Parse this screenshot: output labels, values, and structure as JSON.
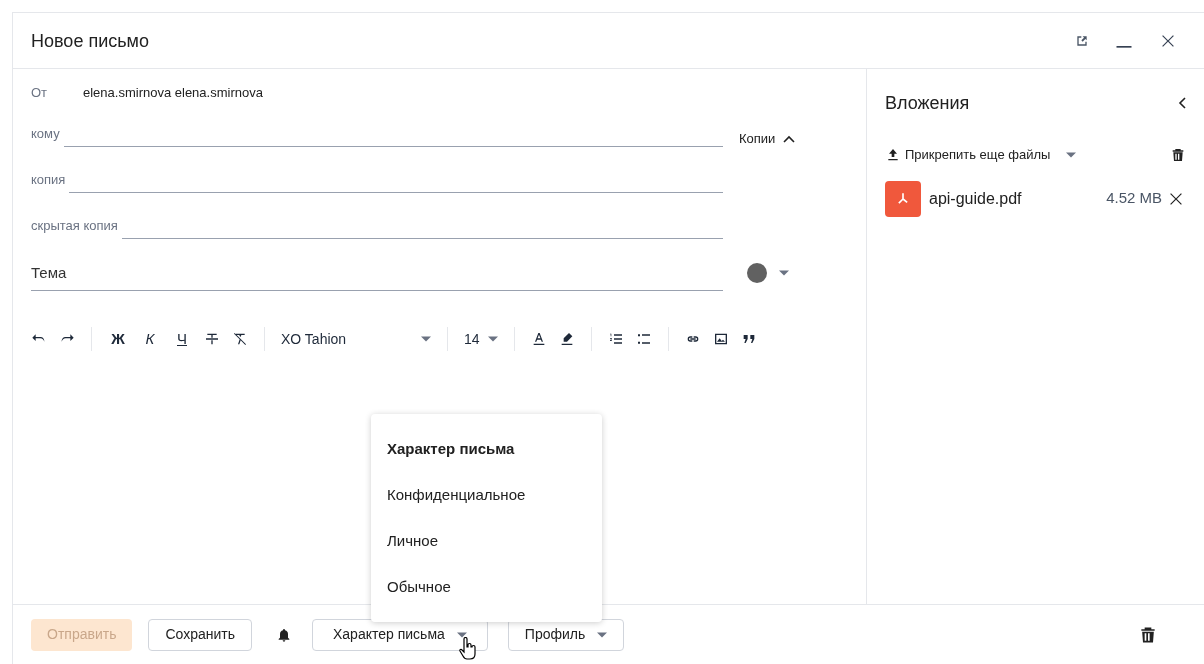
{
  "window": {
    "title": "Новое письмо"
  },
  "from": {
    "label": "От",
    "value": "elena.smirnova elena.smirnova"
  },
  "copies_toggle": {
    "label": "Копии",
    "expanded": true
  },
  "recipients": [
    {
      "label": "кому"
    },
    {
      "label": "копия"
    },
    {
      "label": "скрытая копия"
    }
  ],
  "subject": {
    "placeholder": "Тема"
  },
  "toolbar": {
    "bold": "Ж",
    "italic": "К",
    "underline": "Ч",
    "font": "XO Tahion",
    "size": "14"
  },
  "menu": {
    "title": "Характер письма",
    "items": [
      {
        "label": "Конфиденциальное"
      },
      {
        "label": "Личное"
      },
      {
        "label": "Обычное"
      }
    ]
  },
  "attachments": {
    "title": "Вложения",
    "attach_label": "Прикрепить еще файлы",
    "files": [
      {
        "name": "api-guide.pdf",
        "size": "4.52 MB"
      }
    ]
  },
  "footer": {
    "send": {
      "label": "Отправить",
      "disabled": true
    },
    "save": "Сохранить",
    "character": "Характер письма",
    "profile": "Профиль"
  }
}
